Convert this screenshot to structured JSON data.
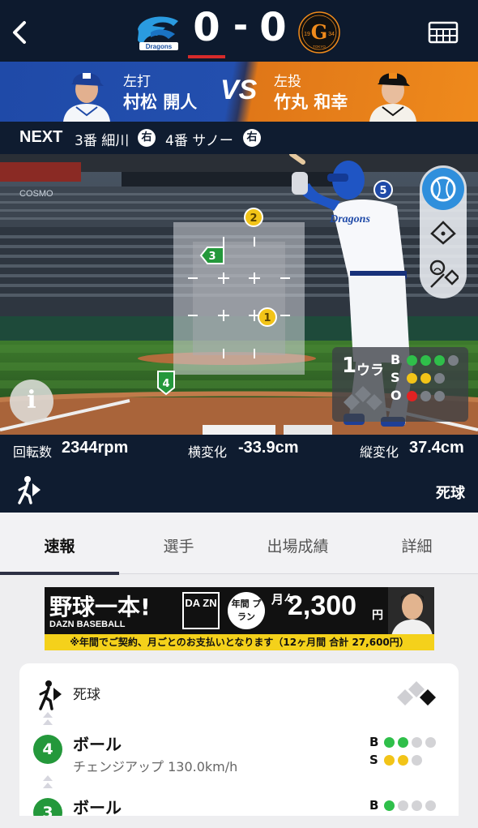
{
  "header": {
    "score_home": "0",
    "score_dash": "-",
    "score_away": "0",
    "home_logo_text": "Dragons",
    "away_logo_top": "19",
    "away_logo_bottom": "34",
    "away_logo_sub": "TOKYO"
  },
  "matchup": {
    "batter_role": "左打",
    "batter_name": "村松 開人",
    "vs": "VS",
    "pitcher_role": "左投",
    "pitcher_name": "竹丸 和幸"
  },
  "next": {
    "label": "NEXT",
    "batter1": "3番 細川",
    "batter1_hand": "右",
    "batter2": "4番 サノー",
    "batter2_hand": "右"
  },
  "stage": {
    "pitches": [
      {
        "num": "1",
        "color": "#f2c418"
      },
      {
        "num": "2",
        "color": "#f2c418"
      },
      {
        "num": "3",
        "color": "#24983b"
      },
      {
        "num": "4",
        "color": "#24983b"
      },
      {
        "num": "5",
        "color": "#1f4aa8"
      }
    ],
    "banner_text": "COSMO",
    "uniform_text": "Dragons",
    "info_label": "i",
    "inning": "1",
    "inning_half": "ウラ",
    "count": {
      "balls_label": "B",
      "strikes_label": "S",
      "outs_label": "O",
      "balls": 3,
      "strikes": 2,
      "outs": 1,
      "ball_color": "#2fbf4a",
      "strike_color": "#f2c418",
      "out_color": "#e22222"
    }
  },
  "stats": {
    "spin_label": "回転数",
    "spin_value": "2344rpm",
    "hbreak_label": "横変化",
    "hbreak_value": "-33.9cm",
    "vbreak_label": "縦変化",
    "vbreak_value": "37.4cm",
    "result": "死球"
  },
  "tabs": [
    "速報",
    "選手",
    "出場成績",
    "詳細"
  ],
  "ad": {
    "title": "野球一本!",
    "subtitle": "DAZN BASEBALL",
    "dazn": "DA ZN",
    "plan": "年間 プラン",
    "monthly": "月々",
    "price": "2,300",
    "yen": "円",
    "note": "※年間でご契約、月ごとのお支払いとなります（12ヶ月間 合計 27,600円）"
  },
  "pbp": {
    "result": "死球",
    "pitches": [
      {
        "num": "4",
        "result": "ボール",
        "type": "チェンジアップ 130.0km/h",
        "balls": 2,
        "strikes": 2
      },
      {
        "num": "3",
        "result": "ボール",
        "type": "",
        "balls": 1,
        "strikes": 0
      }
    ],
    "balls_label": "B",
    "strikes_label": "S"
  }
}
